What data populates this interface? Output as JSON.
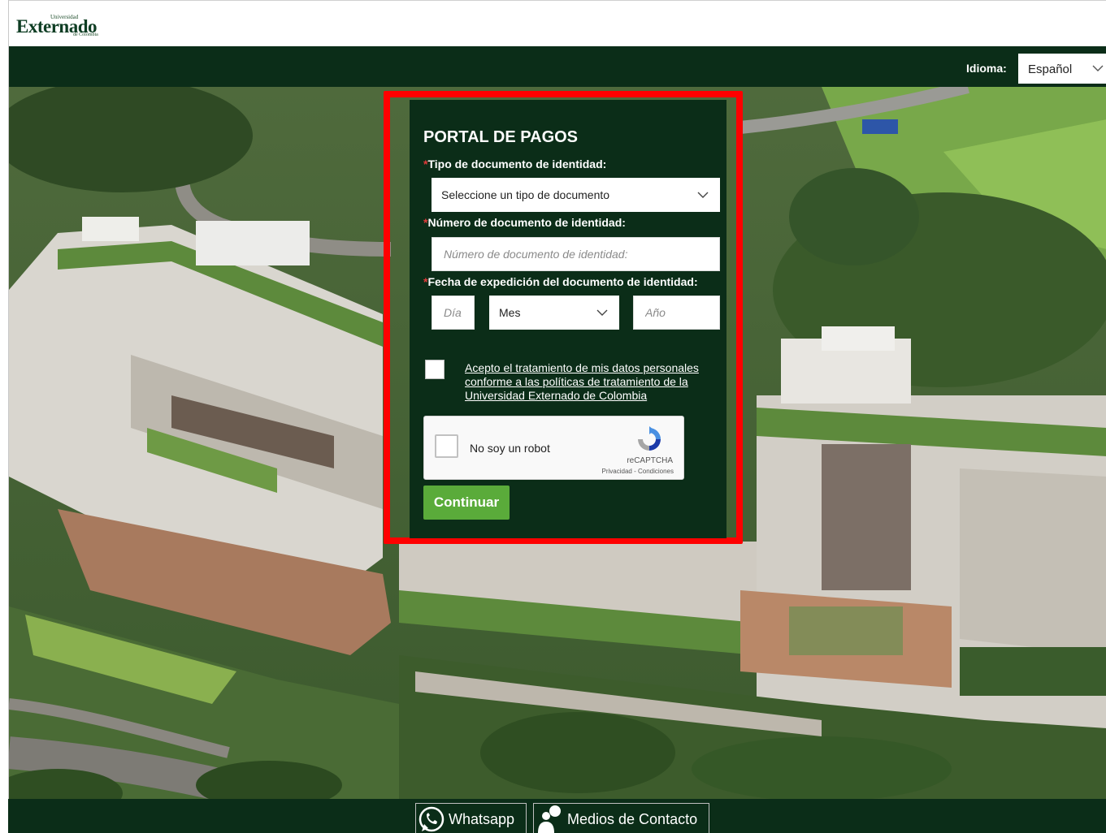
{
  "header": {
    "logo": {
      "top": "Universidad",
      "main": "Externado",
      "bottom": "de Colombia"
    },
    "language_label": "Idioma:",
    "language_value": "Español"
  },
  "form": {
    "title": "PORTAL DE PAGOS",
    "required_mark": "*",
    "doc_type_label": "Tipo de documento de identidad:",
    "doc_type_value": "Seleccione un tipo de documento",
    "doc_number_label": "Número de documento de identidad:",
    "doc_number_placeholder": "Número de documento de identidad:",
    "issue_date_label": "Fecha de expedición del documento de identidad:",
    "day_placeholder": "Día",
    "month_value": "Mes",
    "year_placeholder": "Año",
    "consent_text": "Acepto el tratamiento de mis datos personales conforme a las políticas de tratamiento de la Universidad Externado de Colombia",
    "recaptcha_label": "No soy un robot",
    "recaptcha_brand": "reCAPTCHA",
    "recaptcha_terms": "Privacidad - Condiciones",
    "continue_label": "Continuar"
  },
  "footer": {
    "whatsapp_label": "Whatsapp",
    "contact_label": "Medios de Contacto"
  },
  "colors": {
    "brand_dark_green": "#0b2d18",
    "button_green": "#5aab3a",
    "highlight_red": "#ff0000",
    "required_red": "#e03a3a"
  },
  "icons": [
    "chevron-down-icon",
    "recaptcha-logo-icon",
    "whatsapp-icon",
    "contact-person-icon"
  ]
}
